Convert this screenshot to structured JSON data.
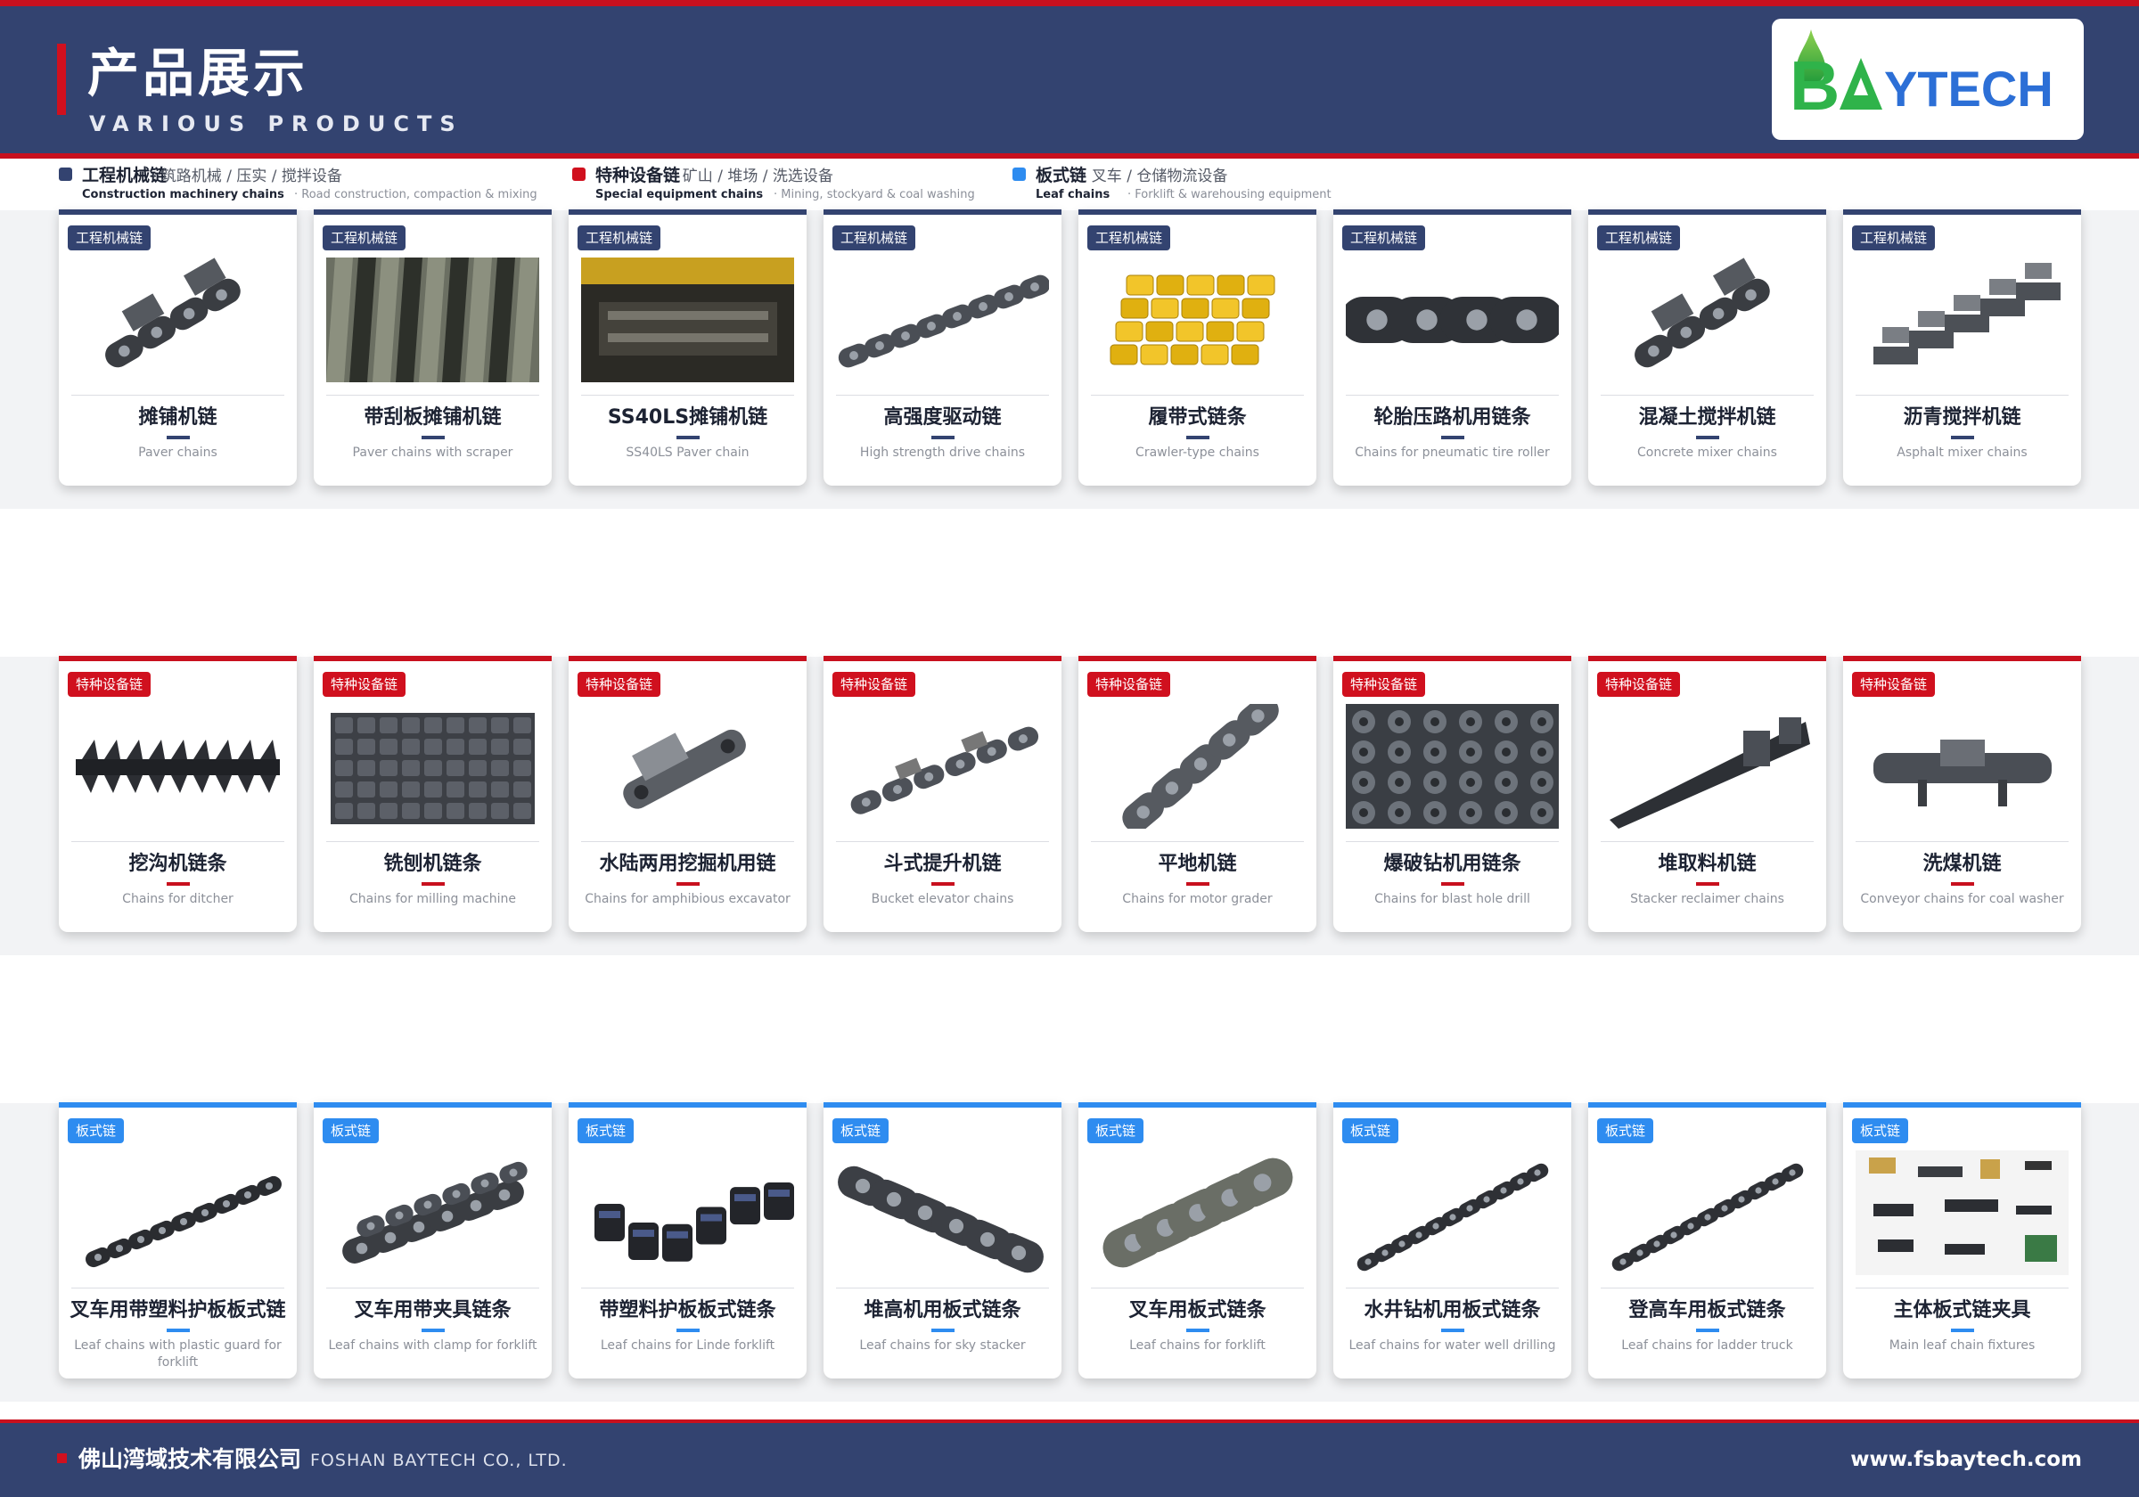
{
  "header": {
    "title": "产品展示",
    "subtitle": "VARIOUS PRODUCTS",
    "logo_text": "BAYTECH"
  },
  "legend": [
    {
      "cn": "工程机械链",
      "desc": "· 筑路机械 / 压实 / 搅拌设备",
      "en": "Construction machinery chains",
      "en_desc": "· Road construction, compaction & mixing",
      "color": "#334370"
    },
    {
      "cn": "特种设备链",
      "desc": "· 矿山 / 堆场 / 洗选设备",
      "en": "Special equipment chains",
      "en_desc": "· Mining, stockyard & coal washing",
      "color": "#d0101e"
    },
    {
      "cn": "板式链",
      "desc": "· 叉车 / 仓储物流设备",
      "en": "Leaf chains",
      "en_desc": "· Forklift & warehousing equipment",
      "color": "#2e8cf0"
    }
  ],
  "rows": [
    {
      "tag": "工程机械链",
      "products": [
        {
          "cn": "摊铺机链",
          "en": "Paver chains",
          "icon": "attachment-chain-icon"
        },
        {
          "cn": "带刮板摊铺机链",
          "en": "Paver chains with scraper",
          "icon": "scraper-bars-photo-icon"
        },
        {
          "cn": "SS40LS摊铺机链",
          "en": "SS40LS Paver chain",
          "icon": "paver-machine-photo-icon"
        },
        {
          "cn": "高强度驱动链",
          "en": "High strength drive chains",
          "icon": "roller-chain-icon"
        },
        {
          "cn": "履带式链条",
          "en": "Crawler-type chains",
          "icon": "yellow-crawler-chain-icon"
        },
        {
          "cn": "轮胎压路机用链条",
          "en": "Chains for pneumatic tire roller",
          "icon": "heavy-roller-chain-icon"
        },
        {
          "cn": "混凝土搅拌机链",
          "en": "Concrete mixer chains",
          "icon": "attachment-chain-icon"
        },
        {
          "cn": "沥青搅拌机链",
          "en": "Asphalt mixer chains",
          "icon": "stacked-attachment-chain-icon"
        }
      ]
    },
    {
      "tag": "特种设备链",
      "products": [
        {
          "cn": "挖沟机链条",
          "en": "Chains for ditcher",
          "icon": "ditcher-chain-icon"
        },
        {
          "cn": "铣刨机链条",
          "en": "Chains for milling machine",
          "icon": "wide-plate-chain-icon"
        },
        {
          "cn": "水陆两用挖掘机用链",
          "en": "Chains for amphibious excavator",
          "icon": "plate-attachment-icon"
        },
        {
          "cn": "斗式提升机链",
          "en": "Bucket elevator chains",
          "icon": "bucket-elevator-chain-icon"
        },
        {
          "cn": "平地机链",
          "en": "Chains for motor grader",
          "icon": "grader-chain-icon"
        },
        {
          "cn": "爆破钻机用链条",
          "en": "Chains for blast hole drill",
          "icon": "multi-strand-chain-icon"
        },
        {
          "cn": "堆取料机链",
          "en": "Stacker reclaimer chains",
          "icon": "stacker-chain-icon"
        },
        {
          "cn": "洗煤机链",
          "en": "Conveyor chains for coal washer",
          "icon": "conveyor-link-icon"
        }
      ]
    },
    {
      "tag": "板式链",
      "products": [
        {
          "cn": "叉车用带塑料护板板式链",
          "en": "Leaf chains with plastic guard for forklift",
          "icon": "leaf-chain-icon"
        },
        {
          "cn": "叉车用带夹具链条",
          "en": "Leaf chains with clamp for forklift",
          "icon": "clamp-leaf-chain-icon"
        },
        {
          "cn": "带塑料护板板式链条",
          "en": "Leaf chains for Linde forklift",
          "icon": "guard-leaf-chain-icon"
        },
        {
          "cn": "堆高机用板式链条",
          "en": "Leaf chains for sky stacker",
          "icon": "wide-leaf-chain-icon"
        },
        {
          "cn": "叉车用板式链条",
          "en": "Leaf chains for forklift",
          "icon": "leaf-chain-block-icon"
        },
        {
          "cn": "水井钻机用板式链条",
          "en": "Leaf chains for water well drilling",
          "icon": "long-leaf-chain-icon"
        },
        {
          "cn": "登高车用板式链条",
          "en": "Leaf chains for ladder truck",
          "icon": "long-leaf-chain-icon"
        },
        {
          "cn": "主体板式链夹具",
          "en": "Main leaf chain fixtures",
          "icon": "fixtures-collage-icon"
        }
      ]
    }
  ],
  "footer": {
    "company_cn": "佛山湾域技术有限公司",
    "company_en": "FOSHAN BAYTECH CO., LTD.",
    "url": "www.fsbaytech.com"
  },
  "colors": {
    "navy": "#334370",
    "red": "#c8101e",
    "blue": "#2e8cf0",
    "logo_green": "#2fb34a",
    "logo_blue": "#2c6fd6"
  }
}
